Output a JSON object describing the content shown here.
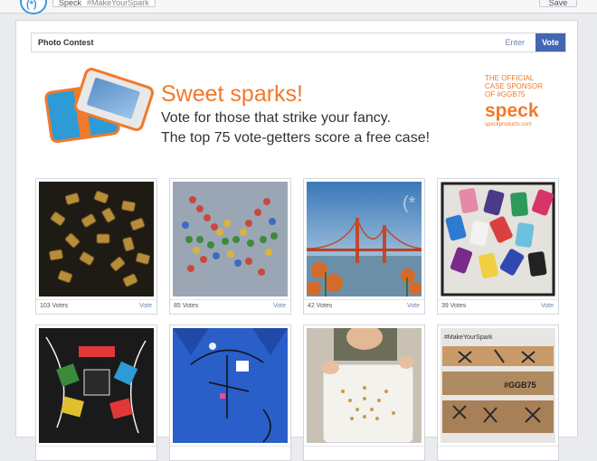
{
  "topbar": {
    "logo_glyph": "(*)",
    "crumb_label": "Speck",
    "crumb_tag": "#MakeYourSpark",
    "save_label": "Save"
  },
  "tabs": {
    "title": "Photo Contest",
    "enter": "Enter",
    "vote": "Vote"
  },
  "banner": {
    "headline": "Sweet sparks!",
    "line1": "Vote for those that strike your fancy.",
    "line2": "The top 75 vote-getters score a free case!",
    "sponsor_line1": "THE OFFICIAL",
    "sponsor_line2": "CASE SPONSOR",
    "sponsor_line3": "OF #GGB75",
    "sponsor_brand": "speck",
    "sponsor_url": "speckproducts.com",
    "brand_color": "#f07a2b"
  },
  "entries": [
    {
      "votes": "103 Votes",
      "action": "Vote",
      "subject": "gold-bullet-sparks"
    },
    {
      "votes": "85 Votes",
      "action": "Vote",
      "subject": "candy-spark-letters"
    },
    {
      "votes": "42 Votes",
      "action": "Vote",
      "subject": "golden-gate-bridge"
    },
    {
      "votes": "39 Votes",
      "action": "Vote",
      "subject": "colorful-phone-cases"
    },
    {
      "votes": "",
      "action": "",
      "subject": "cable-spark-sculpture"
    },
    {
      "votes": "",
      "action": "",
      "subject": "blue-shirt-spark"
    },
    {
      "votes": "",
      "action": "",
      "subject": "child-with-tray"
    },
    {
      "votes": "",
      "action": "",
      "subject": "wood-spark-collage"
    }
  ],
  "collage_labels": {
    "tag1": "#MakeYourSpark",
    "tag2": "#GGB75"
  }
}
